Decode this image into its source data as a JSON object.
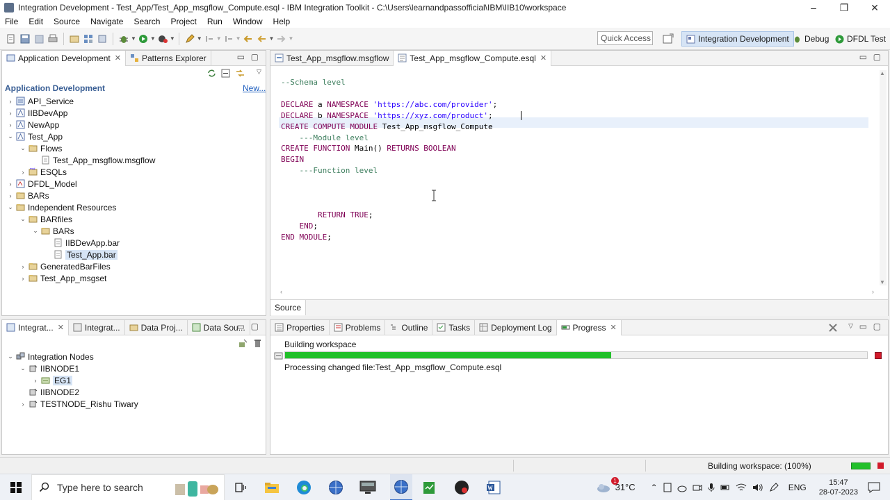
{
  "window": {
    "title": "Integration Development - Test_App/Test_App_msgflow_Compute.esql - IBM Integration Toolkit - C:\\Users\\learnandpassofficial\\IBM\\IIB10\\workspace",
    "minimize": "–",
    "restore": "❐",
    "close": "✕"
  },
  "menu": [
    "File",
    "Edit",
    "Source",
    "Navigate",
    "Search",
    "Project",
    "Run",
    "Window",
    "Help"
  ],
  "quick_access": "Quick Access",
  "perspectives": [
    "Integration Development",
    "Debug",
    "DFDL Test"
  ],
  "left_panel": {
    "tabs": [
      "Application Development",
      "Patterns Explorer"
    ],
    "heading": "Application Development",
    "new_link": "New...",
    "tree": [
      {
        "label": "API_Service",
        "indent": 0,
        "toggle": "›"
      },
      {
        "label": "IIBDevApp",
        "indent": 0,
        "toggle": "›"
      },
      {
        "label": "NewApp",
        "indent": 0,
        "toggle": "›"
      },
      {
        "label": "Test_App",
        "indent": 0,
        "toggle": "⌄"
      },
      {
        "label": "Flows",
        "indent": 1,
        "toggle": "⌄"
      },
      {
        "label": "Test_App_msgflow.msgflow",
        "indent": 2,
        "toggle": ""
      },
      {
        "label": "ESQLs",
        "indent": 1,
        "toggle": "›"
      },
      {
        "label": "DFDL_Model",
        "indent": 0,
        "toggle": "›"
      },
      {
        "label": "BARs",
        "indent": 0,
        "toggle": "›"
      },
      {
        "label": "Independent Resources",
        "indent": 0,
        "toggle": "⌄"
      },
      {
        "label": "BARfiles",
        "indent": 1,
        "toggle": "⌄"
      },
      {
        "label": "BARs",
        "indent": 2,
        "toggle": "⌄"
      },
      {
        "label": "IIBDevApp.bar",
        "indent": 3,
        "toggle": ""
      },
      {
        "label": "Test_App.bar",
        "indent": 3,
        "toggle": ""
      },
      {
        "label": "GeneratedBarFiles",
        "indent": 1,
        "toggle": "›"
      },
      {
        "label": "Test_App_msgset",
        "indent": 1,
        "toggle": "›"
      }
    ]
  },
  "editor": {
    "tabs": [
      "Test_App_msgflow.msgflow",
      "Test_App_msgflow_Compute.esql"
    ],
    "bottom_tab": "Source",
    "lines": [
      {
        "parts": [
          {
            "t": "--Schema level",
            "c": "cm"
          }
        ]
      },
      {
        "parts": []
      },
      {
        "parts": [
          {
            "t": "DECLARE",
            "c": "kw"
          },
          {
            "t": " a ",
            "c": "pl"
          },
          {
            "t": "NAMESPACE",
            "c": "kw"
          },
          {
            "t": " 'https://abc.com/provider'",
            "c": "str"
          },
          {
            "t": ";",
            "c": "pl"
          }
        ]
      },
      {
        "parts": [
          {
            "t": "DECLARE",
            "c": "kw"
          },
          {
            "t": " b ",
            "c": "pl"
          },
          {
            "t": "NAMESPACE",
            "c": "kw"
          },
          {
            "t": " 'https://xyz.com/product'",
            "c": "str"
          },
          {
            "t": ";",
            "c": "pl"
          }
        ]
      },
      {
        "parts": [
          {
            "t": "CREATE COMPUTE MODULE",
            "c": "kw"
          },
          {
            "t": " Test_App_msgflow_Compute",
            "c": "pl"
          }
        ]
      },
      {
        "parts": [
          {
            "t": "    ---Module level",
            "c": "cm"
          }
        ]
      },
      {
        "parts": [
          {
            "t": "CREATE FUNCTION",
            "c": "kw"
          },
          {
            "t": " Main() ",
            "c": "pl"
          },
          {
            "t": "RETURNS BOOLEAN",
            "c": "kw"
          }
        ]
      },
      {
        "parts": [
          {
            "t": "BEGIN",
            "c": "kw"
          }
        ]
      },
      {
        "parts": [
          {
            "t": "    ---Function level",
            "c": "cm"
          }
        ]
      },
      {
        "parts": []
      },
      {
        "parts": []
      },
      {
        "parts": []
      },
      {
        "parts": [
          {
            "t": "        RETURN TRUE",
            "c": "kw"
          },
          {
            "t": ";",
            "c": "pl"
          }
        ]
      },
      {
        "parts": [
          {
            "t": "    END",
            "c": "kw"
          },
          {
            "t": ";",
            "c": "pl"
          }
        ]
      },
      {
        "parts": [
          {
            "t": "END MODULE",
            "c": "kw"
          },
          {
            "t": ";",
            "c": "pl"
          }
        ]
      }
    ]
  },
  "bottom_left": {
    "tabs": [
      "Integrat...",
      "Integrat...",
      "Data Proj...",
      "Data Sou..."
    ],
    "tree": [
      {
        "label": "Integration Nodes",
        "indent": 0,
        "toggle": "⌄"
      },
      {
        "label": "IIBNODE1",
        "indent": 1,
        "toggle": "⌄"
      },
      {
        "label": "EG1",
        "indent": 2,
        "toggle": "›"
      },
      {
        "label": "IIBNODE2",
        "indent": 1,
        "toggle": ""
      },
      {
        "label": "TESTNODE_Rishu Tiwary",
        "indent": 1,
        "toggle": "›"
      }
    ]
  },
  "bottom_right": {
    "tabs": [
      "Properties",
      "Problems",
      "Outline",
      "Tasks",
      "Deployment Log",
      "Progress"
    ],
    "progress_title": "Building workspace",
    "progress_fraction": 0.56,
    "progress_detail": "Processing changed file:Test_App_msgflow_Compute.esql"
  },
  "status_bar": {
    "text": "Building workspace: (100%)"
  },
  "taskbar": {
    "search_placeholder": "Type here to search",
    "weather": "31°C",
    "notification_badge": "1",
    "language": "ENG",
    "time": "15:47",
    "date": "28-07-2023"
  },
  "colors": {
    "progress_green": "#22c02a",
    "keyword": "#7f0055",
    "comment": "#3f7f5f",
    "string": "#2a00ff",
    "selection": "#d6e4f5"
  }
}
